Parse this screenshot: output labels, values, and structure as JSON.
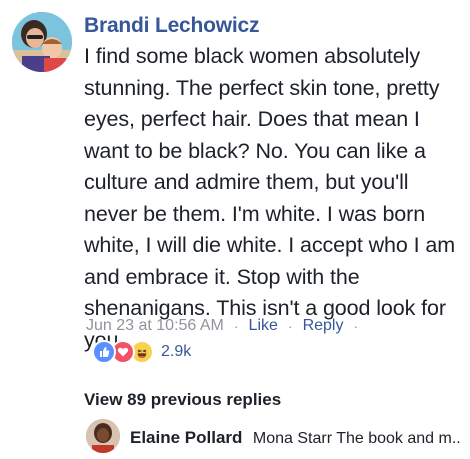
{
  "comment": {
    "author": "Brandi Lechowicz",
    "text": "I find some black women absolutely stunning. The perfect skin tone, pretty eyes, perfect hair. Does that mean I want to be black? No. You can like a culture and admire them, but you'll never be them. I'm white. I was born white, I will die white. I accept who I am and embrace it. Stop with the shenanigans. This isn't a good look for you.",
    "timestamp": "Jun 23 at 10:56 AM",
    "separator": "·",
    "like_label": "Like",
    "reply_label": "Reply",
    "reactions": {
      "icons": [
        "like-icon",
        "love-icon",
        "haha-icon"
      ],
      "count": "2.9k",
      "colors": {
        "like": "#5890ff",
        "love": "#f25268",
        "haha": "#f7d14f"
      }
    }
  },
  "replies": {
    "view_previous_label": "View 89 previous replies",
    "latest": {
      "author": "Elaine Pollard",
      "text": "Mona Starr The book and m..."
    }
  },
  "colors": {
    "link": "#365899",
    "meta": "#90949c",
    "text": "#1d2129"
  }
}
